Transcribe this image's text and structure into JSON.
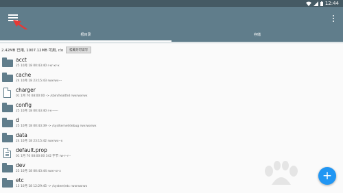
{
  "statusbar": {
    "time": "12:44"
  },
  "tabs": [
    {
      "label": "根目录",
      "active": true
    },
    {
      "label": "存储",
      "active": false
    }
  ],
  "info": {
    "text": "2.42MB 已用, 1007.12MB 可用, r/o",
    "button": "挂载为可读写"
  },
  "files": [
    {
      "name": "acct",
      "type": "folder",
      "meta": "25 10月 18 00:43:40   r-xr-xr-x"
    },
    {
      "name": "cache",
      "type": "folder",
      "meta": "24 10月 18 23:15:43   rwxrwx---"
    },
    {
      "name": "charger",
      "type": "file",
      "meta": "01 1月 70 08:00:00  -> /sbin/healthd  rwxrwxrwx"
    },
    {
      "name": "config",
      "type": "folder",
      "meta": "25 10月 18 00:43:40   r-x------"
    },
    {
      "name": "d",
      "type": "folder",
      "meta": "25 10月 18 00:43:39  -> /sys/kernel/debug  rwxrwxrwx"
    },
    {
      "name": "data",
      "type": "folder",
      "meta": "24 10月 18 23:15:42   rwxrwx--x"
    },
    {
      "name": "default.prop",
      "type": "file",
      "meta": "01 1月 70 08:00:00   342 字节   rw-r--r--"
    },
    {
      "name": "dev",
      "type": "folder",
      "meta": "25 10月 18 00:43:44   rwxr-xr-x"
    },
    {
      "name": "etc",
      "type": "folder",
      "meta": "15 10月 18 12:29:45  -> /system/etc  rwxrwxrwx"
    }
  ],
  "fab": {
    "symbol": "+"
  },
  "colors": {
    "primary": "#607d8b",
    "statusbar": "#455a64",
    "accent": "#2196f3",
    "arrow": "#e53935"
  }
}
